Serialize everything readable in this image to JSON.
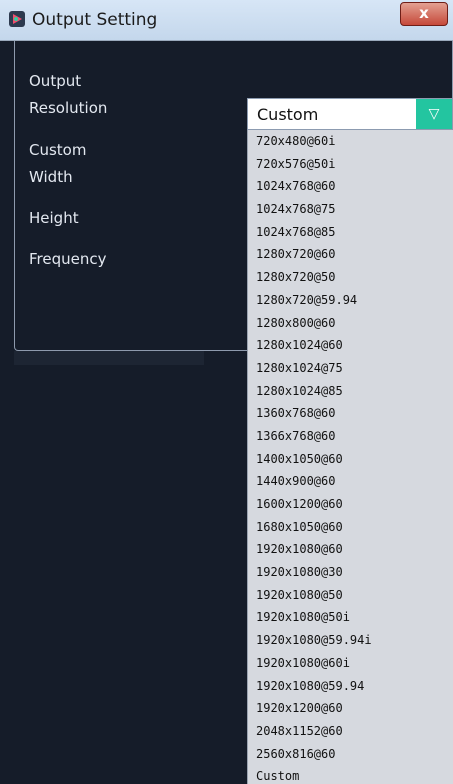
{
  "window": {
    "title": "Output Setting",
    "close_label": "x"
  },
  "form": {
    "output_label": "Output",
    "resolution_label": "Resolution",
    "custom_label": "Custom",
    "width_label": "Width",
    "height_label": "Height",
    "frequency_label": "Frequency"
  },
  "resolution_select": {
    "value": "Custom",
    "arrow": "▽",
    "accent_color": "#23c5a0",
    "options": [
      "720x480@60i",
      "720x576@50i",
      "1024x768@60",
      "1024x768@75",
      "1024x768@85",
      "1280x720@60",
      "1280x720@50",
      "1280x720@59.94",
      "1280x800@60",
      "1280x1024@60",
      "1280x1024@75",
      "1280x1024@85",
      "1360x768@60",
      "1366x768@60",
      "1400x1050@60",
      "1440x900@60",
      "1600x1200@60",
      "1680x1050@60",
      "1920x1080@60",
      "1920x1080@30",
      "1920x1080@50",
      "1920x1080@50i",
      "1920x1080@59.94i",
      "1920x1080@60i",
      "1920x1080@59.94",
      "1920x1200@60",
      "2048x1152@60",
      "2560x816@60",
      "Custom"
    ]
  }
}
